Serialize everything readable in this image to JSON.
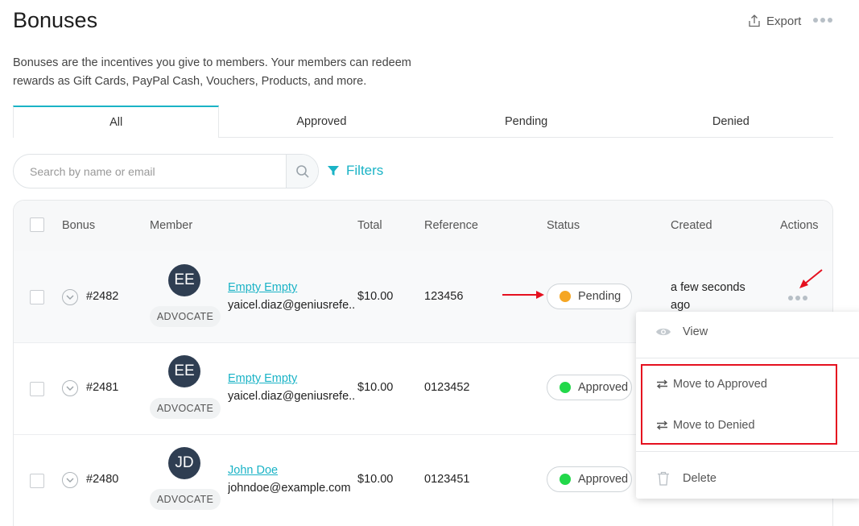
{
  "header": {
    "title": "Bonuses",
    "export_label": "Export",
    "description": "Bonuses are the incentives you give to members. Your members can redeem rewards as Gift Cards, PayPal Cash, Vouchers, Products, and more."
  },
  "tabs": [
    {
      "label": "All",
      "active": true
    },
    {
      "label": "Approved",
      "active": false
    },
    {
      "label": "Pending",
      "active": false
    },
    {
      "label": "Denied",
      "active": false
    }
  ],
  "search": {
    "placeholder": "Search by name or email",
    "value": ""
  },
  "filters_label": "Filters",
  "table": {
    "columns": [
      "Bonus",
      "Member",
      "Total",
      "Reference",
      "Status",
      "Created",
      "Actions"
    ],
    "rows": [
      {
        "id": "#2482",
        "initials": "EE",
        "role": "ADVOCATE",
        "name": "Empty Empty",
        "email": "yaicel.diaz@geniusrefe...",
        "total": "$10.00",
        "reference": "123456",
        "status": "Pending",
        "status_color": "#f5a623",
        "created": "a few seconds ago"
      },
      {
        "id": "#2481",
        "initials": "EE",
        "role": "ADVOCATE",
        "name": "Empty Empty",
        "email": "yaicel.diaz@geniusrefe...",
        "total": "$10.00",
        "reference": "0123452",
        "status": "Approved",
        "status_color": "#22d84a",
        "created": ""
      },
      {
        "id": "#2480",
        "initials": "JD",
        "role": "ADVOCATE",
        "name": "John Doe",
        "email": "johndoe@example.com",
        "total": "$10.00",
        "reference": "0123451",
        "status": "Approved",
        "status_color": "#22d84a",
        "created": ""
      }
    ]
  },
  "actions_menu": {
    "items": [
      {
        "label": "View",
        "icon": "eye-icon"
      },
      {
        "label": "Move to Approved",
        "icon": "swap-icon"
      },
      {
        "label": "Move to Denied",
        "icon": "swap-icon"
      },
      {
        "label": "Delete",
        "icon": "trash-icon"
      }
    ]
  },
  "colors": {
    "accent": "#1ab3c6",
    "highlight": "#e5101f",
    "avatar_bg": "#2f3e52"
  }
}
